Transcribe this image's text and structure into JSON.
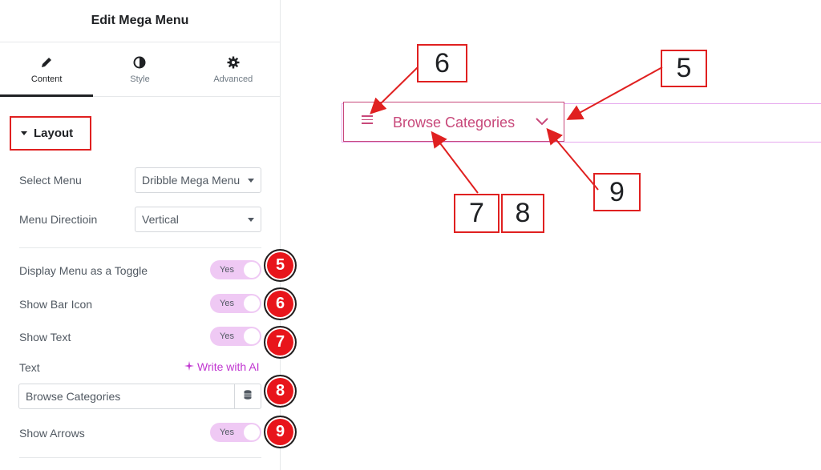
{
  "panel": {
    "title": "Edit Mega Menu",
    "tabs": [
      {
        "label": "Content",
        "icon": "pencil-icon",
        "active": true
      },
      {
        "label": "Style",
        "icon": "half-circle-icon",
        "active": false
      },
      {
        "label": "Advanced",
        "icon": "gear-icon",
        "active": false
      }
    ],
    "section": {
      "title": "Layout"
    },
    "select_menu": {
      "label": "Select Menu",
      "value": "Dribble Mega Menu"
    },
    "menu_direction": {
      "label": "Menu Directioin",
      "value": "Vertical"
    },
    "display_toggle": {
      "label": "Display Menu as a Toggle",
      "value": "Yes",
      "badge": "5"
    },
    "show_bar_icon": {
      "label": "Show Bar Icon",
      "value": "Yes",
      "badge": "6"
    },
    "show_text": {
      "label": "Show Text",
      "value": "Yes",
      "badge": "7"
    },
    "text_field": {
      "label": "Text",
      "ai_link": "Write with AI",
      "value": "Browse Categories",
      "badge": "8"
    },
    "show_arrows": {
      "label": "Show Arrows",
      "value": "Yes",
      "badge": "9"
    }
  },
  "preview": {
    "menu_text": "Browse Categories",
    "callouts": {
      "c6": "6",
      "c5": "5",
      "c7": "7",
      "c8": "8",
      "c9": "9"
    }
  },
  "colors": {
    "accent_pink": "#c8487a",
    "toggle_bg": "#efc9f4",
    "badge_red": "#e8151b",
    "annotation_red": "#e02020",
    "ai_purple": "#c036d0"
  }
}
